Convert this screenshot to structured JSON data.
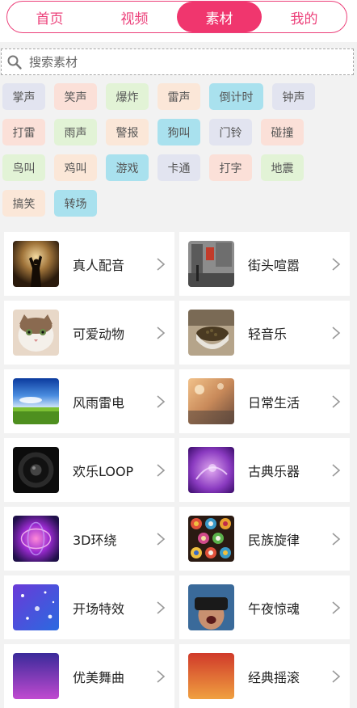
{
  "tabs": [
    {
      "label": "首页",
      "active": false
    },
    {
      "label": "视频",
      "active": false
    },
    {
      "label": "素材",
      "active": true
    },
    {
      "label": "我的",
      "active": false
    }
  ],
  "search": {
    "placeholder": "搜索素材",
    "icon": "search-icon"
  },
  "tags": [
    {
      "label": "掌声",
      "color": "#e2e4f0"
    },
    {
      "label": "笑声",
      "color": "#fbe0d8"
    },
    {
      "label": "爆炸",
      "color": "#e2f3d6"
    },
    {
      "label": "雷声",
      "color": "#fbe7d8"
    },
    {
      "label": "倒计时",
      "color": "#a9e1ee"
    },
    {
      "label": "钟声",
      "color": "#e2e4f0"
    },
    {
      "label": "打雷",
      "color": "#fbe0d8"
    },
    {
      "label": "雨声",
      "color": "#e2f3d6"
    },
    {
      "label": "警报",
      "color": "#fbe7d8"
    },
    {
      "label": "狗叫",
      "color": "#a9e1ee"
    },
    {
      "label": "门铃",
      "color": "#e2e4f0"
    },
    {
      "label": "碰撞",
      "color": "#fbe0d8"
    },
    {
      "label": "鸟叫",
      "color": "#e2f3d6"
    },
    {
      "label": "鸡叫",
      "color": "#fbe7d8"
    },
    {
      "label": "游戏",
      "color": "#a9e1ee"
    },
    {
      "label": "卡通",
      "color": "#e2e4f0"
    },
    {
      "label": "打字",
      "color": "#fbe0d8"
    },
    {
      "label": "地震",
      "color": "#e2f3d6"
    },
    {
      "label": "搞笑",
      "color": "#fbe7d8"
    },
    {
      "label": "转场",
      "color": "#a9e1ee"
    }
  ],
  "categories": [
    {
      "label": "真人配音",
      "thumb": "concert-silhouette"
    },
    {
      "label": "街头喧嚣",
      "thumb": "street-scene"
    },
    {
      "label": "可爱动物",
      "thumb": "cat"
    },
    {
      "label": "轻音乐",
      "thumb": "coffee-beans"
    },
    {
      "label": "风雨雷电",
      "thumb": "grass-sky"
    },
    {
      "label": "日常生活",
      "thumb": "blurred-street"
    },
    {
      "label": "欢乐LOOP",
      "thumb": "speaker"
    },
    {
      "label": "古典乐器",
      "thumb": "purple-abstract"
    },
    {
      "label": "3D环绕",
      "thumb": "purple-swirl"
    },
    {
      "label": "民族旋律",
      "thumb": "pattern-mosaic"
    },
    {
      "label": "开场特效",
      "thumb": "blue-sparkles"
    },
    {
      "label": "午夜惊魂",
      "thumb": "vr-headset"
    },
    {
      "label": "优美舞曲",
      "thumb": "violet-lights"
    },
    {
      "label": "经典摇滚",
      "thumb": "stage-lights"
    }
  ],
  "colors": {
    "accent": "#f0366e",
    "tab_border": "#ec407a"
  }
}
